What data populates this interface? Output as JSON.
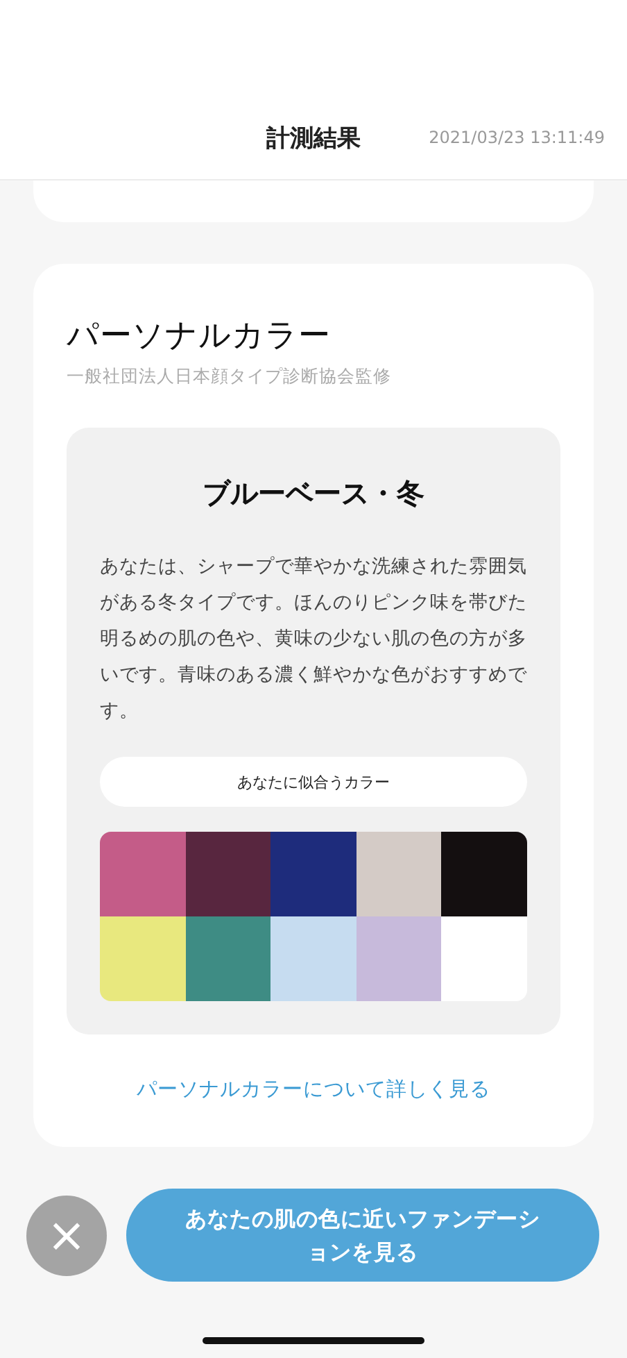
{
  "header": {
    "title": "計測結果",
    "timestamp": "2021/03/23 13:11:49"
  },
  "personal_color": {
    "title": "パーソナルカラー",
    "supervisor": "一般社団法人日本顔タイプ診断協会監修",
    "result": {
      "type": "ブルーベース・冬",
      "description": "あなたは、シャープで華やかな洗練された雰囲気がある冬タイプです。ほんのりピンク味を帯びた明るめの肌の色や、黄味の少ない肌の色の方が多いです。青味のある濃く鮮やかな色がおすすめです。",
      "palette_label": "あなたに似合うカラー",
      "swatches": [
        {
          "color": "#c45c88"
        },
        {
          "color": "#58263f"
        },
        {
          "color": "#1e2c7c"
        },
        {
          "color": "#d4cbc6"
        },
        {
          "color": "#140f10"
        },
        {
          "color": "#e8e87e"
        },
        {
          "color": "#3e8c84"
        },
        {
          "color": "#c6dcf0"
        },
        {
          "color": "#c7badb"
        },
        {
          "color": "#ffffff"
        }
      ]
    },
    "more_link": "パーソナルカラーについて詳しく見る"
  },
  "actions": {
    "close": "×",
    "foundation_button": "あなたの肌の色に近いファンデーションを見る"
  }
}
